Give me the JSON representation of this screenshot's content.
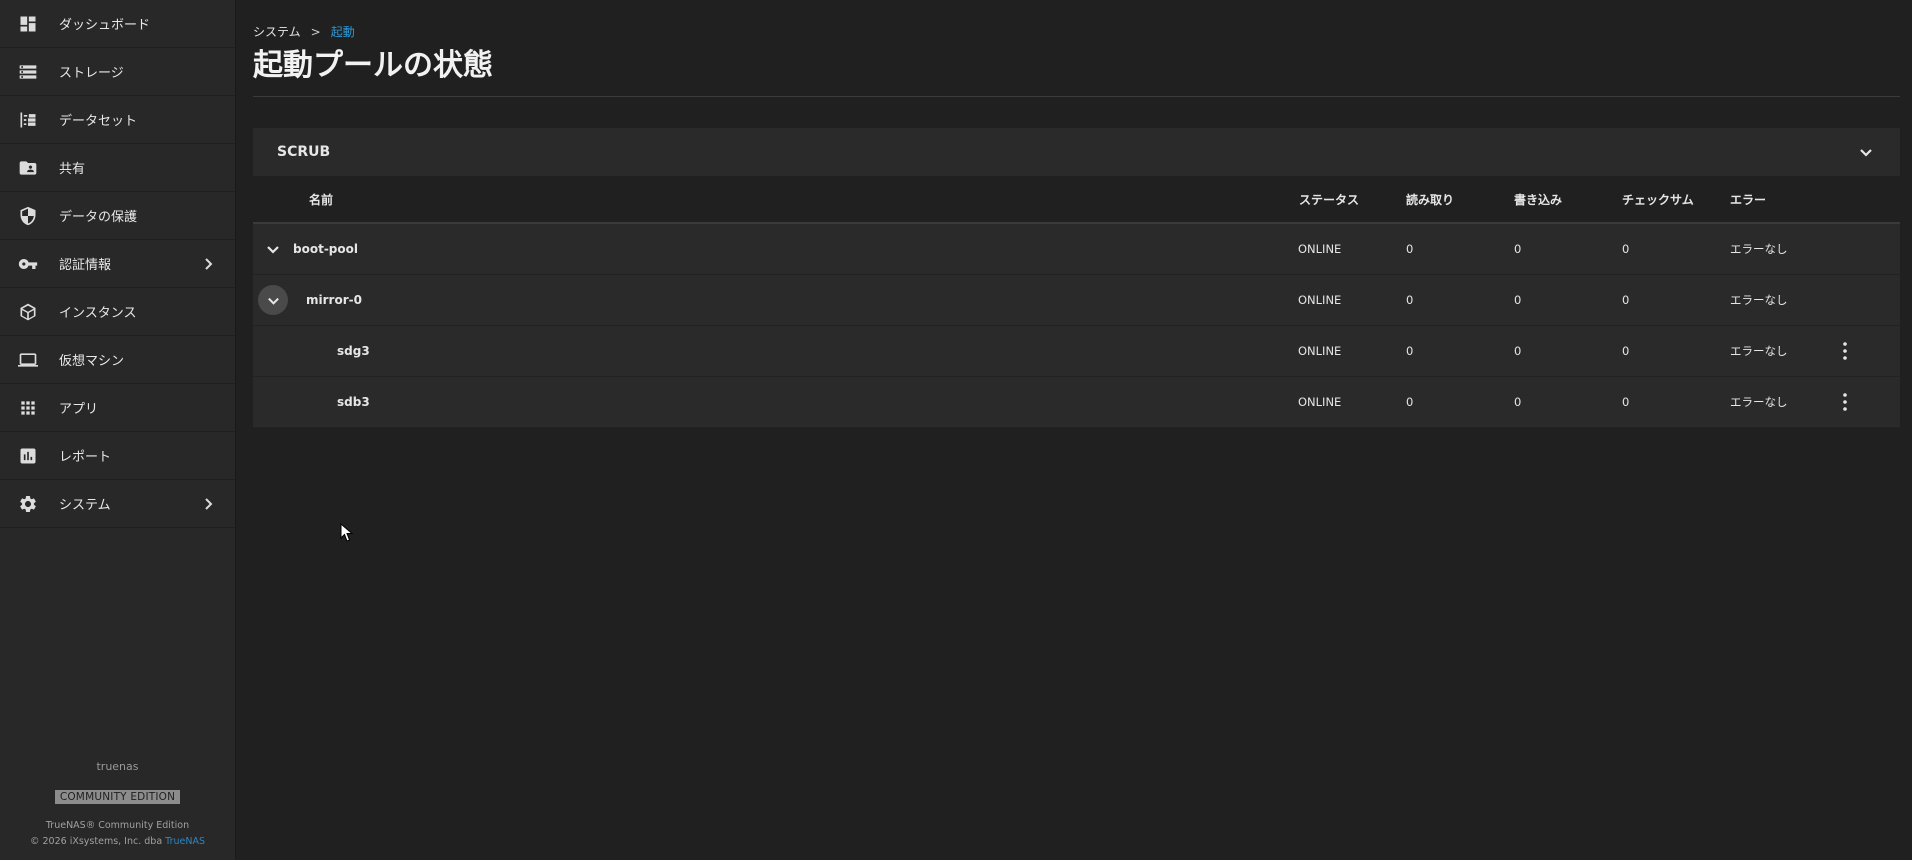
{
  "sidebar": {
    "items": [
      {
        "label": "ダッシュボード",
        "icon": "dashboard-icon"
      },
      {
        "label": "ストレージ",
        "icon": "storage-icon"
      },
      {
        "label": "データセット",
        "icon": "datasets-icon"
      },
      {
        "label": "共有",
        "icon": "shares-icon"
      },
      {
        "label": "データの保護",
        "icon": "shield-icon"
      },
      {
        "label": "認証情報",
        "icon": "key-icon",
        "has_children": true
      },
      {
        "label": "インスタンス",
        "icon": "cube-icon"
      },
      {
        "label": "仮想マシン",
        "icon": "laptop-icon"
      },
      {
        "label": "アプリ",
        "icon": "apps-grid-icon"
      },
      {
        "label": "レポート",
        "icon": "report-chart-icon"
      },
      {
        "label": "システム",
        "icon": "gear-icon",
        "has_children": true
      }
    ],
    "footer": {
      "hostname": "truenas",
      "edition": "COMMUNITY EDITION",
      "product": "TrueNAS® Community Edition",
      "copyright": "© 2026 iXsystems, Inc. dba ",
      "link": "TrueNAS"
    }
  },
  "breadcrumb": {
    "parent": "システム",
    "separator": ">",
    "current": "起動"
  },
  "page_title": "起動プールの状態",
  "scrub": {
    "label": "SCRUB"
  },
  "table": {
    "headers": {
      "name": "名前",
      "status": "ステータス",
      "read": "読み取り",
      "write": "書き込み",
      "checksum": "チェックサム",
      "error": "エラー"
    },
    "rows": [
      {
        "name": "boot-pool",
        "status": "ONLINE",
        "read": "0",
        "write": "0",
        "checksum": "0",
        "error": "エラーなし",
        "level": 0
      },
      {
        "name": "mirror-0",
        "status": "ONLINE",
        "read": "0",
        "write": "0",
        "checksum": "0",
        "error": "エラーなし",
        "level": 1
      },
      {
        "name": "sdg3",
        "status": "ONLINE",
        "read": "0",
        "write": "0",
        "checksum": "0",
        "error": "エラーなし",
        "level": 2
      },
      {
        "name": "sdb3",
        "status": "ONLINE",
        "read": "0",
        "write": "0",
        "checksum": "0",
        "error": "エラーなし",
        "level": 2
      }
    ]
  },
  "colors": {
    "background": "#202020",
    "sidebar": "#282828",
    "row": "#2a2a2a",
    "accent": "#2e9ad6"
  }
}
